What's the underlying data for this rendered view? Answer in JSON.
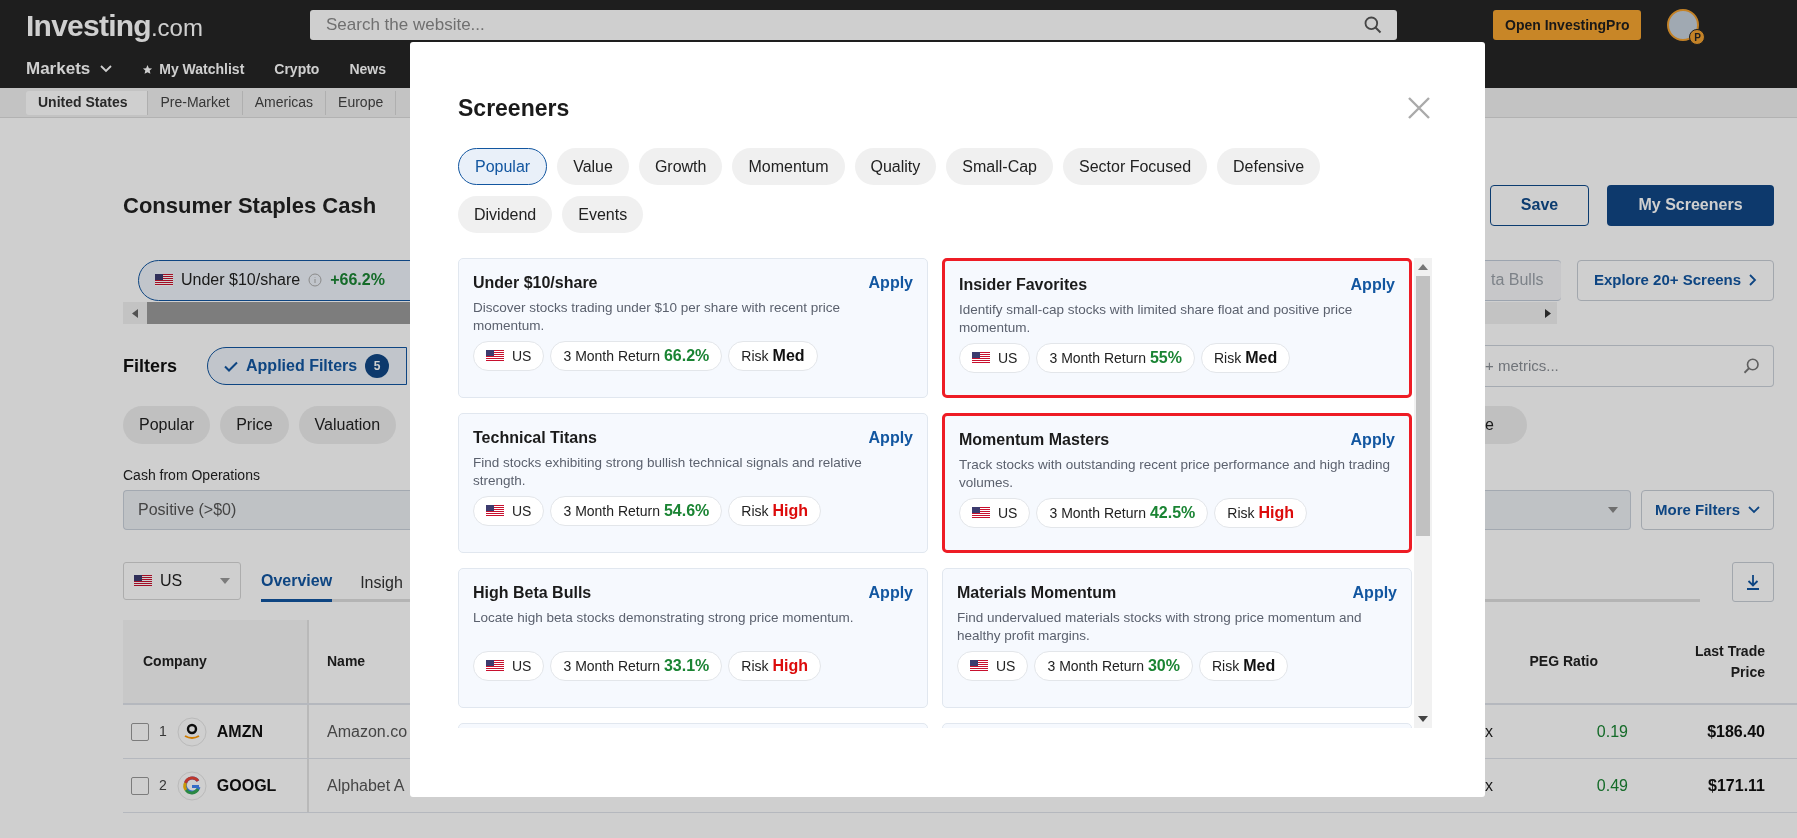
{
  "header": {
    "logo": "Investing",
    "logo_suffix": ".com",
    "search_placeholder": "Search the website...",
    "pro_button": "Open InvestingPro",
    "avatar_badge": "P"
  },
  "nav": [
    {
      "label": "Markets",
      "kind": "dropdown"
    },
    {
      "label": "My Watchlist",
      "kind": "star"
    },
    {
      "label": "Crypto",
      "kind": "plain"
    },
    {
      "label": "News",
      "kind": "plain"
    }
  ],
  "subnav": [
    {
      "label": "United States",
      "selected": true
    },
    {
      "label": "Pre-Market",
      "selected": false
    },
    {
      "label": "Americas",
      "selected": false
    },
    {
      "label": "Europe",
      "selected": false
    }
  ],
  "page": {
    "title": "Consumer Staples Cash",
    "save": "Save",
    "my_screeners": "My Screeners",
    "screen_chip": {
      "label": "Under $10/share",
      "return": "+66.2%"
    },
    "partial_chip": "ta Bulls",
    "explore": "Explore 20+ Screens",
    "filters_label": "Filters",
    "applied_filters": {
      "label": "Applied Filters",
      "count": "5"
    },
    "metrics_search": "+ metrics...",
    "categories": [
      "Popular",
      "Price",
      "Valuation"
    ],
    "partial_category": "e",
    "filter": {
      "label": "Cash from Operations",
      "value": "Positive (>$0)"
    },
    "more_filters": "More Filters",
    "market": "US",
    "tabs": [
      {
        "label": "Overview",
        "selected": true
      },
      {
        "label": "Insigh",
        "selected": false
      }
    ],
    "table": {
      "columns": [
        "Company",
        "Name",
        "PEG Ratio",
        "Last Trade Price"
      ],
      "rows": [
        {
          "checked": false,
          "index": "1",
          "kind": "amazon",
          "ticker": "AMZN",
          "name": "Amazon.co",
          "column_3": "x",
          "peg": "0.19",
          "price": "$186.40"
        },
        {
          "checked": false,
          "index": "2",
          "kind": "google",
          "ticker": "GOOGL",
          "name": "Alphabet A",
          "column_3": "x",
          "peg": "0.49",
          "price": "$171.11"
        }
      ]
    }
  },
  "modal": {
    "title": "Screeners",
    "tabs": [
      {
        "label": "Popular",
        "selected": true
      },
      {
        "label": "Value",
        "selected": false
      },
      {
        "label": "Growth",
        "selected": false
      },
      {
        "label": "Momentum",
        "selected": false
      },
      {
        "label": "Quality",
        "selected": false
      },
      {
        "label": "Small-Cap",
        "selected": false
      },
      {
        "label": "Sector Focused",
        "selected": false
      },
      {
        "label": "Defensive",
        "selected": false
      },
      {
        "label": "Dividend",
        "selected": false
      },
      {
        "label": "Events",
        "selected": false
      }
    ],
    "cards": [
      {
        "title": "Under $10/share",
        "apply": "Apply",
        "description": "Discover stocks trading under $10 per share with recent price momentum.",
        "market": "US",
        "return_label": "3 Month Return",
        "return": "66.2%",
        "risk_label": "Risk",
        "risk": {
          "text": "Med",
          "color": "#111111"
        },
        "highlighted": false
      },
      {
        "title": "Insider Favorites",
        "apply": "Apply",
        "description": "Identify small-cap stocks with limited share float and positive price momentum.",
        "market": "US",
        "return_label": "3 Month Return",
        "return": "55%",
        "risk_label": "Risk",
        "risk": {
          "text": "Med",
          "color": "#111111"
        },
        "highlighted": true
      },
      {
        "title": "Technical Titans",
        "apply": "Apply",
        "description": "Find stocks exhibiting strong bullish technical signals and relative strength.",
        "market": "US",
        "return_label": "3 Month Return",
        "return": "54.6%",
        "risk_label": "Risk",
        "risk": {
          "text": "High",
          "color": "#dc0b0b"
        },
        "highlighted": false
      },
      {
        "title": "Momentum Masters",
        "apply": "Apply",
        "description": "Track stocks with outstanding recent price performance and high trading volumes.",
        "market": "US",
        "return_label": "3 Month Return",
        "return": "42.5%",
        "risk_label": "Risk",
        "risk": {
          "text": "High",
          "color": "#dc0b0b"
        },
        "highlighted": true
      },
      {
        "title": "High Beta Bulls",
        "apply": "Apply",
        "description": "Locate high beta stocks demonstrating strong price momentum.",
        "market": "US",
        "return_label": "3 Month Return",
        "return": "33.1%",
        "risk_label": "Risk",
        "risk": {
          "text": "High",
          "color": "#dc0b0b"
        },
        "highlighted": false
      },
      {
        "title": "Materials Momentum",
        "apply": "Apply",
        "description": "Find undervalued materials stocks with strong price momentum and healthy profit margins.",
        "market": "US",
        "return_label": "3 Month Return",
        "return": "30%",
        "risk_label": "Risk",
        "risk": {
          "text": "Med",
          "color": "#111111"
        },
        "highlighted": false
      }
    ]
  }
}
